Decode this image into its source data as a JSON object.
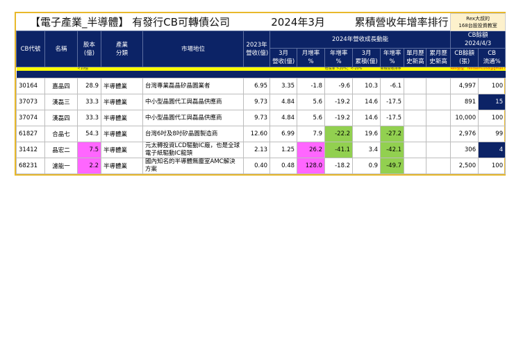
{
  "title": {
    "main": "【電子產業_半導體】 有發行CB可轉債公司",
    "period": "2024年3月",
    "ranking": "累積營收年增率排行",
    "badge_line1": "Rex大叔的",
    "badge_line2": "168台股投資教室"
  },
  "header": {
    "cb_code": "CB代號",
    "name": "名稱",
    "capital_1": "股本",
    "capital_2": "(億)",
    "industry_1": "產業",
    "industry_2": "分類",
    "market": "市場地位",
    "rev2023_1": "2023年",
    "rev2023_2": "營收(億)",
    "growth_group": "2024年營收成長動能",
    "cb_group_1": "CB餘額",
    "cb_group_2": "2024/4/3",
    "mar_rev_1": "3月",
    "mar_rev_2": "營收(億)",
    "mom_1": "月增率",
    "mom_2": "%",
    "yoy_1": "年增率",
    "yoy_2": "%",
    "cum_1": "3月",
    "cum_2": "累積(億)",
    "cum_yoy_1": "年增率",
    "cum_yoy_2": "%",
    "single_high_1": "單月歷",
    "single_high_2": "史新高",
    "cum_high_1": "累月歷",
    "cum_high_2": "史新高",
    "cb_bal_1": "CB餘額",
    "cb_bal_2": "(張)",
    "cb_float_1": "CB",
    "cb_float_2": "流通%"
  },
  "notes": {
    "capital": "<10億",
    "growth": "增長率 >20%；<-20%",
    "cum": "累積營收排序",
    "contact": "Rex整理：rexdashu168@gmail.com"
  },
  "colors": {
    "navy": "#0c2366",
    "pink": "#ff66ff",
    "green": "#92d050",
    "yellow": "#ffff00"
  },
  "rows": [
    {
      "code": "30164",
      "name": "嘉晶四",
      "capital": "28.9",
      "industry": "半導體業",
      "market": "台灣專業磊晶矽晶圓業者",
      "rev2023": "6.95",
      "mar_rev": "3.35",
      "mom": "-1.8",
      "yoy": "-9.6",
      "cum": "10.3",
      "cum_yoy": "-6.1",
      "single_high": "",
      "cum_high": "",
      "cb_bal": "4,997",
      "cb_float": "100"
    },
    {
      "code": "37073",
      "name": "漢磊三",
      "capital": "33.3",
      "industry": "半導體業",
      "market": "中小型晶圓代工與磊晶供應商",
      "rev2023": "9.73",
      "mar_rev": "4.84",
      "mom": "5.6",
      "yoy": "-19.2",
      "cum": "14.6",
      "cum_yoy": "-17.5",
      "single_high": "",
      "cum_high": "",
      "cb_bal": "891",
      "cb_float": "15"
    },
    {
      "code": "37074",
      "name": "漢磊四",
      "capital": "33.3",
      "industry": "半導體業",
      "market": "中小型晶圓代工與磊晶供應商",
      "rev2023": "9.73",
      "mar_rev": "4.84",
      "mom": "5.6",
      "yoy": "-19.2",
      "cum": "14.6",
      "cum_yoy": "-17.5",
      "single_high": "",
      "cum_high": "",
      "cb_bal": "10,000",
      "cb_float": "100"
    },
    {
      "code": "61827",
      "name": "合晶七",
      "capital": "54.3",
      "industry": "半導體業",
      "market": "台灣6吋及8吋矽晶圓製造商",
      "rev2023": "12.60",
      "mar_rev": "6.99",
      "mom": "7.9",
      "yoy": "-22.2",
      "cum": "19.6",
      "cum_yoy": "-27.2",
      "single_high": "",
      "cum_high": "",
      "cb_bal": "2,976",
      "cb_float": "99"
    },
    {
      "code": "31412",
      "name": "晶宏二",
      "capital": "7.5",
      "industry": "半導體業",
      "market": "元太轉投資LCD驅動IC廠，也是全球電子紙驅動IC龍頭",
      "rev2023": "2.13",
      "mar_rev": "1.25",
      "mom": "26.2",
      "yoy": "-41.1",
      "cum": "3.4",
      "cum_yoy": "-42.1",
      "single_high": "",
      "cum_high": "",
      "cb_bal": "306",
      "cb_float": "4"
    },
    {
      "code": "68231",
      "name": "濾能一",
      "capital": "2.2",
      "industry": "半導體業",
      "market": "國內知名的半導體無塵室AMC解決方案",
      "rev2023": "0.40",
      "mar_rev": "0.48",
      "mom": "128.0",
      "yoy": "-18.2",
      "cum": "0.9",
      "cum_yoy": "-49.7",
      "single_high": "",
      "cum_high": "",
      "cb_bal": "2,500",
      "cb_float": "100"
    }
  ]
}
